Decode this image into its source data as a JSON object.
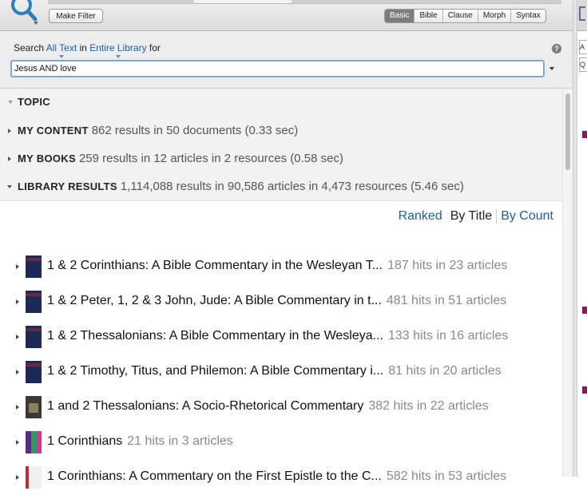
{
  "toolbar": {
    "make_filter": "Make Filter",
    "modes": [
      "Basic",
      "Bible",
      "Clause",
      "Morph",
      "Syntax"
    ],
    "active_mode": "Basic"
  },
  "search": {
    "prefix": "Search",
    "scope": "All Text",
    "in_word": "in",
    "location": "Entire Library",
    "for_word": "for",
    "query": "Jesus AND love",
    "help": "?"
  },
  "sections": [
    {
      "title": "TOPIC",
      "summary": ""
    },
    {
      "title": "MY CONTENT",
      "summary": "862 results in 50 documents (0.33 sec)"
    },
    {
      "title": "MY BOOKS",
      "summary": "259 results in 12 articles in 2 resources (0.58 sec)"
    },
    {
      "title": "LIBRARY RESULTS",
      "summary": "1,114,088 results in 90,586 articles in 4,473 resources (5.46 sec)"
    }
  ],
  "sort": {
    "ranked": "Ranked",
    "by_title": "By Title",
    "by_count": "By Count"
  },
  "results": [
    {
      "title": "1 & 2 Corinthians: A Bible Commentary in the Wesleyan T...",
      "hits": "187 hits in 23 articles"
    },
    {
      "title": "1 & 2 Peter, 1, 2 & 3 John, Jude: A Bible Commentary in t...",
      "hits": "481 hits in 51 articles"
    },
    {
      "title": "1 & 2 Thessalonians: A Bible Commentary in the Wesleya...",
      "hits": "133 hits in 16 articles"
    },
    {
      "title": "1 & 2 Timothy, Titus, and Philemon: A Bible Commentary i...",
      "hits": "81 hits in 20 articles"
    },
    {
      "title": "1 and 2 Thessalonians: A Socio-Rhetorical Commentary",
      "hits": "382 hits in 22 articles"
    },
    {
      "title": "1 Corinthians",
      "hits": "21 hits in 3 articles"
    },
    {
      "title": "1 Corinthians: A Commentary on the First Epistle to the C...",
      "hits": "582 hits in 53 articles"
    }
  ],
  "side_panel": {
    "box1": "A",
    "box2": "Q"
  },
  "colors": {
    "link": "#1a5fb4",
    "accent_mark": "#8a1a57",
    "active_mode": "#7d7d7d"
  }
}
